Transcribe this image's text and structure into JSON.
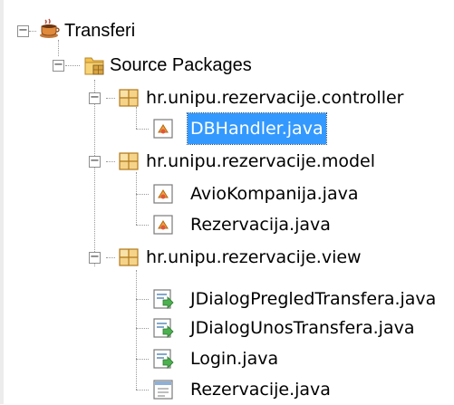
{
  "tree": {
    "project": {
      "label": "Transferi",
      "expanded": true,
      "icon": "coffee-cup-icon"
    },
    "source_packages": {
      "label": "Source Packages",
      "expanded": true,
      "icon": "source-folder-icon"
    },
    "packages": [
      {
        "label": "hr.unipu.rezervacije.controller",
        "expanded": true,
        "files": [
          {
            "label": "DBHandler.java",
            "selected": true,
            "icon": "java-class-icon"
          }
        ]
      },
      {
        "label": "hr.unipu.rezervacije.model",
        "expanded": true,
        "files": [
          {
            "label": "AvioKompanija.java",
            "selected": false,
            "icon": "java-class-icon"
          },
          {
            "label": "Rezervacija.java",
            "selected": false,
            "icon": "java-class-icon"
          }
        ]
      },
      {
        "label": "hr.unipu.rezervacije.view",
        "expanded": true,
        "files": [
          {
            "label": "JDialogPregledTransfera.java",
            "selected": false,
            "icon": "java-form-icon"
          },
          {
            "label": "JDialogUnosTransfera.java",
            "selected": false,
            "icon": "java-form-icon"
          },
          {
            "label": "Login.java",
            "selected": false,
            "icon": "java-form-icon"
          },
          {
            "label": "Rezervacije.java",
            "selected": false,
            "icon": "java-file-icon"
          }
        ]
      }
    ]
  }
}
